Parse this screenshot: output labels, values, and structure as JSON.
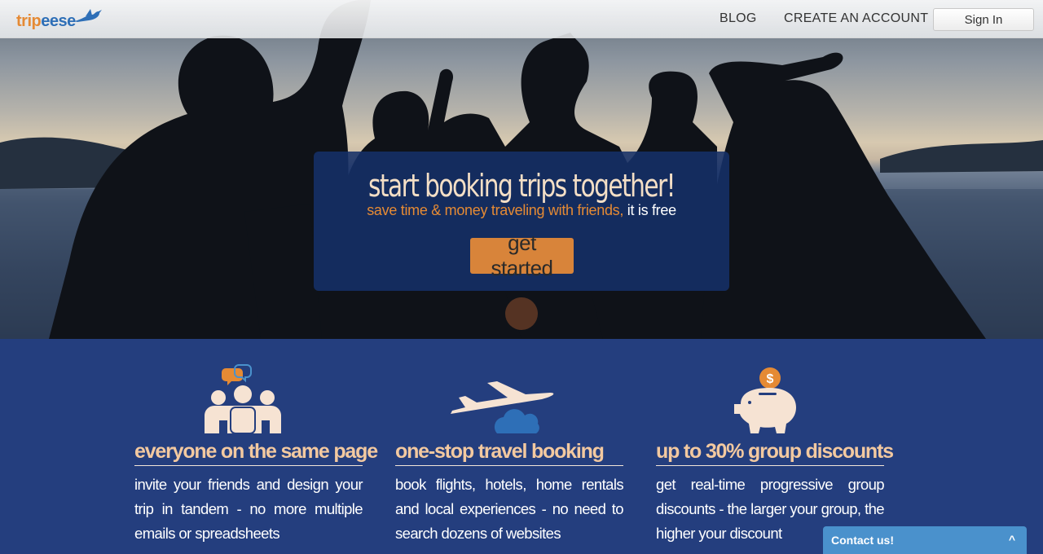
{
  "header": {
    "logo_text_a": "trip",
    "logo_text_b": "eese",
    "nav": {
      "blog": "BLOG",
      "create_account": "CREATE AN ACCOUNT",
      "sign_in": "Sign In"
    }
  },
  "hero": {
    "title": "start booking trips together!",
    "subtitle_highlight": "save time & money traveling with friends,",
    "subtitle_plain": " it is free",
    "cta_label": "get started"
  },
  "features": [
    {
      "title": "everyone on the same page",
      "description": "invite your friends and design your trip in tandem - no more multiple emails or spreadsheets",
      "icon": "group-chat-icon"
    },
    {
      "title": "one-stop travel booking",
      "description": "book flights, hotels, home rentals and local experiences - no need to search dozens of websites",
      "icon": "airplane-icon"
    },
    {
      "title": "up to 30% group discounts",
      "description": "get real-time progressive group discounts - the larger your group, the higher your discount",
      "icon": "piggy-bank-icon"
    }
  ],
  "contact_widget": {
    "label": "Contact us!",
    "chevron": "^"
  },
  "colors": {
    "accent_orange": "#d8843a",
    "feature_bg": "#243e7e",
    "title_peach": "#f3c9a0",
    "contact_blue": "#4a91cc"
  },
  "icon_glyphs": {
    "dollar": "$"
  }
}
